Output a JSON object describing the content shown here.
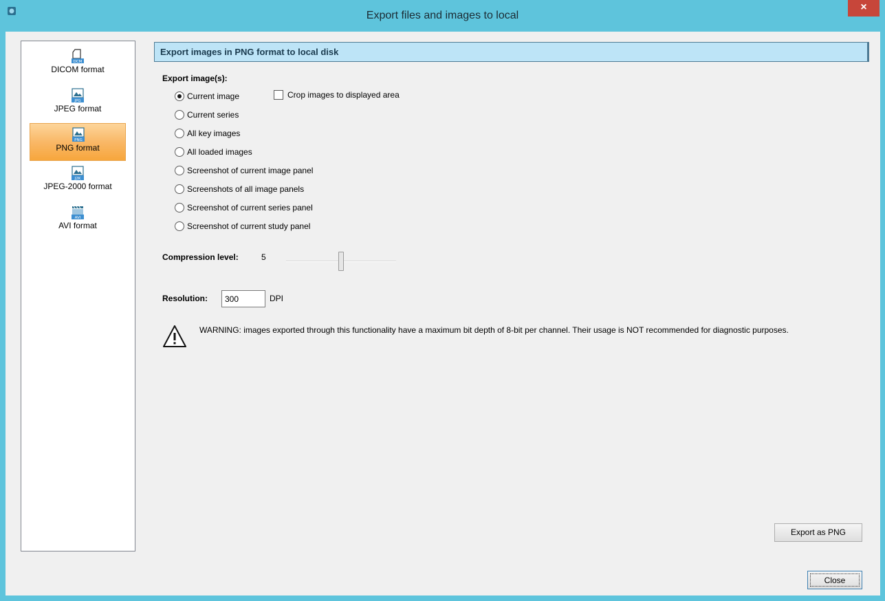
{
  "window": {
    "title": "Export files and images to local",
    "close_glyph": "×",
    "titlebar_color": "#5ec4dc",
    "close_color": "#c7463a"
  },
  "sidebar": {
    "items": [
      {
        "label": "DICOM format",
        "icon": "dicom-file-icon",
        "badge": "DCM",
        "selected": false
      },
      {
        "label": "JPEG format",
        "icon": "jpeg-image-icon",
        "badge": "JPG",
        "selected": false
      },
      {
        "label": "PNG format",
        "icon": "png-image-icon",
        "badge": "PNG",
        "selected": true
      },
      {
        "label": "JPEG-2000 format",
        "icon": "j2k-image-icon",
        "badge": "J2K",
        "selected": false
      },
      {
        "label": "AVI format",
        "icon": "avi-video-icon",
        "badge": "AVI",
        "selected": false
      }
    ],
    "selected_color": "#f9b867"
  },
  "main": {
    "header": "Export images in PNG format to local disk",
    "header_color": "#bde4f7",
    "export_label": "Export image(s):",
    "options": [
      {
        "label": "Current image",
        "checked": true
      },
      {
        "label": "Current series",
        "checked": false
      },
      {
        "label": "All key images",
        "checked": false
      },
      {
        "label": "All loaded images",
        "checked": false
      },
      {
        "label": "Screenshot of current image panel",
        "checked": false
      },
      {
        "label": "Screenshots of all image panels",
        "checked": false
      },
      {
        "label": "Screenshot of current series panel",
        "checked": false
      },
      {
        "label": "Screenshot of current study panel",
        "checked": false
      }
    ],
    "crop": {
      "label": "Crop images to displayed area",
      "checked": false
    },
    "compression": {
      "label": "Compression level:",
      "value": "5",
      "level_fraction": 0.5
    },
    "resolution": {
      "label": "Resolution:",
      "value": "300",
      "unit": "DPI"
    },
    "warning": "WARNING: images exported through this functionality have a maximum bit depth of 8-bit per channel. Their usage is NOT recommended for diagnostic purposes.",
    "export_button": "Export as PNG",
    "close_button": "Close"
  }
}
